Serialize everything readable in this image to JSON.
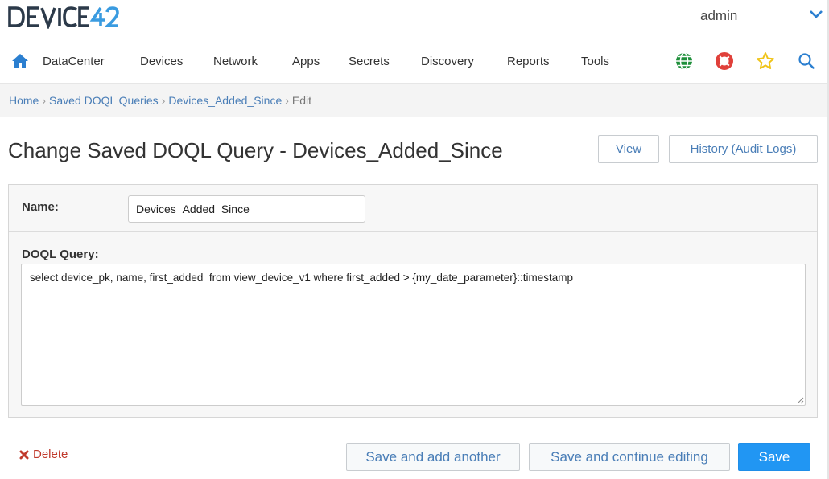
{
  "brand": {
    "logo_text": "DEVICE42",
    "accent": "#2196f3",
    "logo_dark": "#2c3a4a",
    "logo_light": "#3a9be0"
  },
  "user": {
    "name": "admin",
    "menu_icon": "chevron-down-icon"
  },
  "nav": {
    "home_icon": "home-icon",
    "items": [
      "DataCenter",
      "Devices",
      "Network",
      "Apps",
      "Secrets",
      "Discovery",
      "Reports",
      "Tools"
    ],
    "right_icons": [
      "globe-icon",
      "lifebuoy-icon",
      "star-icon",
      "search-icon"
    ]
  },
  "breadcrumb": {
    "items": [
      "Home",
      "Saved DOQL Queries",
      "Devices_Added_Since"
    ],
    "current": "Edit",
    "separator": "›"
  },
  "page": {
    "title": "Change Saved DOQL Query - Devices_Added_Since",
    "view_label": "View",
    "history_label": "History (Audit Logs)"
  },
  "form": {
    "name_label": "Name:",
    "name_value": "Devices_Added_Since",
    "query_label": "DOQL Query:",
    "query_value": "select device_pk, name, first_added  from view_device_v1 where first_added > {my_date_parameter}::timestamp"
  },
  "footer": {
    "delete_label": "Delete",
    "save_add_label": "Save and add another",
    "save_continue_label": "Save and continue editing",
    "save_label": "Save"
  }
}
